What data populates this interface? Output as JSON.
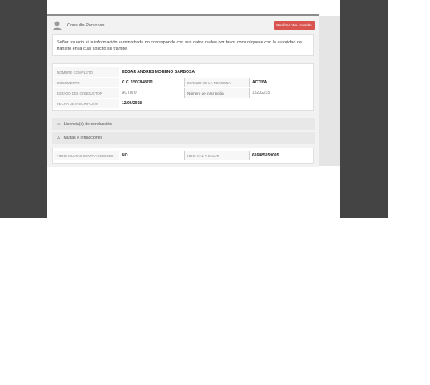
{
  "header": {
    "title": "Consulta Personas",
    "button_label": "Realizar otra consulta"
  },
  "notice": "Señor usuario si la información suministrada no corresponde con sus datos reales por favor comuníquese con la autoridad de tránsito en la cual solicitó su trámite.",
  "person": {
    "nombre_label": "NOMBRE COMPLETO",
    "nombre_value": "EDGAR ANDRES MORENO BARBOSA",
    "documento_label": "DOCUMENTO",
    "documento_value": "C.C. 1507848701",
    "estado_persona_label": "ESTADO DE LA PERSONA",
    "estado_persona_value": "ACTIVA",
    "estado_conductor_label": "ESTADO DEL CONDUCTOR",
    "estado_conductor_value": "ACTIVO",
    "inscripcion_label": "Número de inscripción",
    "inscripcion_value": "18202235",
    "fecha_label": "FECHA DE INSCRIPCIÓN",
    "fecha_value": "12/06/2018"
  },
  "sections": {
    "licencias": "Licencia(s) de conducción",
    "multas": "Multas e infracciones"
  },
  "multas": {
    "tiene_label": "TIENE MULTAS O INFRACCIONES",
    "tiene_value": "NO",
    "paz_label": "NRO. PAZ Y SALVO",
    "paz_value": "616485059095"
  },
  "icons": {
    "user": "user-silhouette-icon",
    "license": "id-card-icon",
    "fines": "warning-icon"
  },
  "colors": {
    "button": "#d9534f",
    "side_panels": "#444444"
  }
}
